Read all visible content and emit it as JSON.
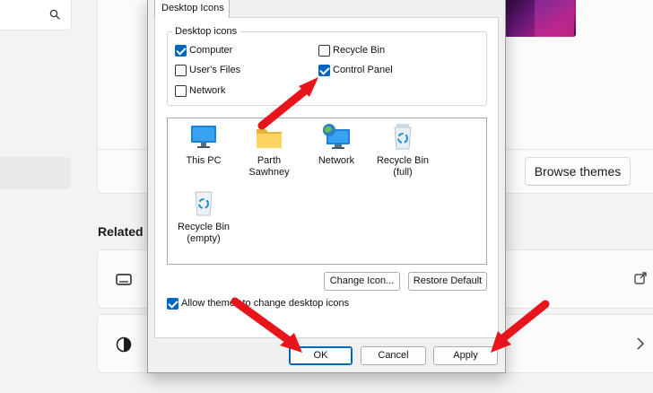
{
  "settings": {
    "related_heading": "Related s",
    "browse_button": "Browse themes"
  },
  "dialog": {
    "tab_label": "Desktop Icons",
    "group_label": "Desktop icons",
    "checkboxes": [
      {
        "label": "Computer",
        "checked": true
      },
      {
        "label": "Recycle Bin",
        "checked": false
      },
      {
        "label": "User's Files",
        "checked": false
      },
      {
        "label": "Control Panel",
        "checked": true
      },
      {
        "label": "Network",
        "checked": false
      }
    ],
    "icons": [
      {
        "line1": "This PC",
        "line2": "",
        "icon": "monitor-icon"
      },
      {
        "line1": "Parth",
        "line2": "Sawhney",
        "icon": "folder-icon"
      },
      {
        "line1": "Network",
        "line2": "",
        "icon": "network-icon"
      },
      {
        "line1": "Recycle Bin",
        "line2": "(full)",
        "icon": "recycle-bin-full-icon"
      },
      {
        "line1": "Recycle Bin",
        "line2": "(empty)",
        "icon": "recycle-bin-empty-icon"
      }
    ],
    "change_icon_button": "Change Icon...",
    "restore_default_button": "Restore Default",
    "allow_themes_label": "Allow themes to change desktop icons",
    "allow_themes_checked": true,
    "ok_button": "OK",
    "cancel_button": "Cancel",
    "apply_button": "Apply"
  },
  "colors": {
    "accent": "#0067c0",
    "annotation_arrow": "#e8141c"
  }
}
